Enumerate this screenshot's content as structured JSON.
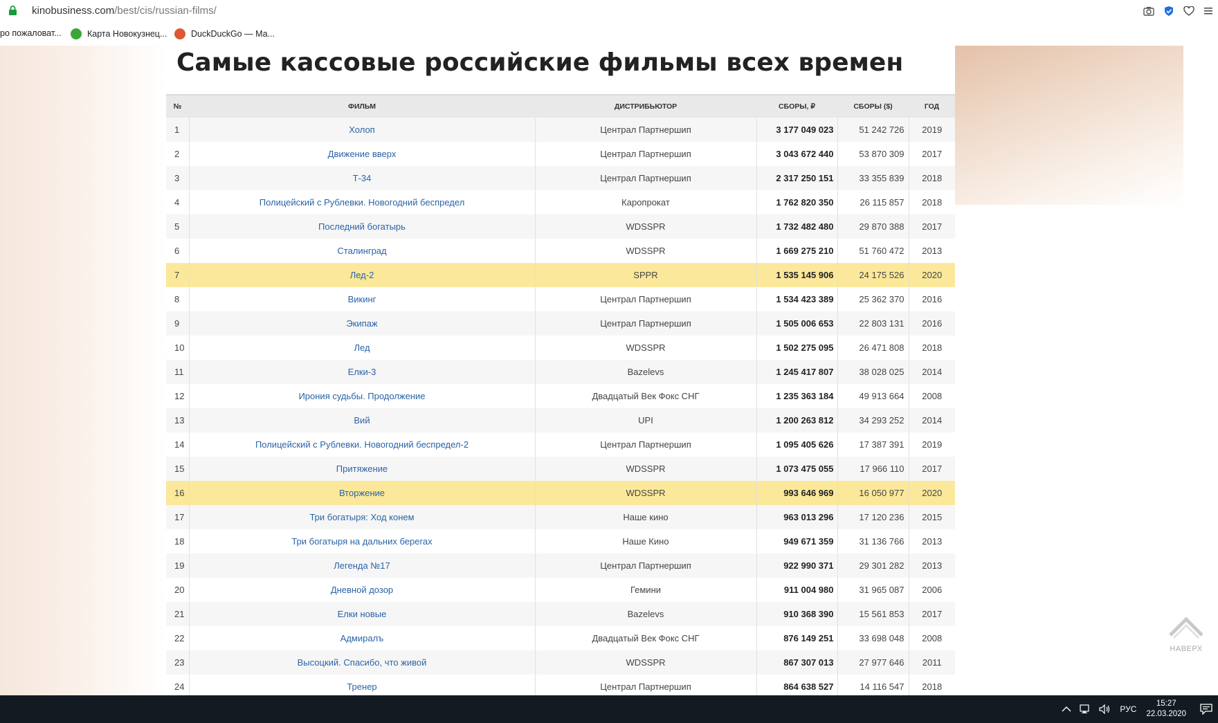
{
  "browser": {
    "url_host": "kinobusiness.com",
    "url_path": "/best/cis/russian-films/",
    "bookmarks": [
      {
        "label": "ро пожаловат..."
      },
      {
        "label": "Карта Новокузнец..."
      },
      {
        "label": "DuckDuckGo — Ма..."
      }
    ]
  },
  "page": {
    "title": "Самые кассовые российские фильмы всех времен",
    "back_to_top": "НАВЕРХ"
  },
  "table": {
    "headers": {
      "num": "№",
      "film": "ФИЛЬМ",
      "distributor": "ДИСТРИБЬЮТОР",
      "gross_rub": "СБОРЫ, ₽",
      "gross_usd": "СБОРЫ ($)",
      "year": "ГОД"
    },
    "rows": [
      {
        "num": "1",
        "film": "Холоп",
        "distributor": "Централ Партнершип",
        "gross_rub": "3 177 049 023",
        "gross_usd": "51 242 726",
        "year": "2019",
        "highlight": false
      },
      {
        "num": "2",
        "film": "Движение вверх",
        "distributor": "Централ Партнершип",
        "gross_rub": "3 043 672 440",
        "gross_usd": "53 870 309",
        "year": "2017",
        "highlight": false
      },
      {
        "num": "3",
        "film": "Т-34",
        "distributor": "Централ Партнершип",
        "gross_rub": "2 317 250 151",
        "gross_usd": "33 355 839",
        "year": "2018",
        "highlight": false
      },
      {
        "num": "4",
        "film": "Полицейский с Рублевки. Новогодний беспредел",
        "distributor": "Каропрокат",
        "gross_rub": "1 762 820 350",
        "gross_usd": "26 115 857",
        "year": "2018",
        "highlight": false
      },
      {
        "num": "5",
        "film": "Последний богатырь",
        "distributor": "WDSSPR",
        "gross_rub": "1 732 482 480",
        "gross_usd": "29 870 388",
        "year": "2017",
        "highlight": false
      },
      {
        "num": "6",
        "film": "Сталинград",
        "distributor": "WDSSPR",
        "gross_rub": "1 669 275 210",
        "gross_usd": "51 760 472",
        "year": "2013",
        "highlight": false
      },
      {
        "num": "7",
        "film": "Лед-2",
        "distributor": "SPPR",
        "gross_rub": "1 535 145 906",
        "gross_usd": "24 175 526",
        "year": "2020",
        "highlight": true
      },
      {
        "num": "8",
        "film": "Викинг",
        "distributor": "Централ Партнершип",
        "gross_rub": "1 534 423 389",
        "gross_usd": "25 362 370",
        "year": "2016",
        "highlight": false
      },
      {
        "num": "9",
        "film": "Экипаж",
        "distributor": "Централ Партнершип",
        "gross_rub": "1 505 006 653",
        "gross_usd": "22 803 131",
        "year": "2016",
        "highlight": false
      },
      {
        "num": "10",
        "film": "Лед",
        "distributor": "WDSSPR",
        "gross_rub": "1 502 275 095",
        "gross_usd": "26 471 808",
        "year": "2018",
        "highlight": false
      },
      {
        "num": "11",
        "film": "Елки-3",
        "distributor": "Bazelevs",
        "gross_rub": "1 245 417 807",
        "gross_usd": "38 028 025",
        "year": "2014",
        "highlight": false
      },
      {
        "num": "12",
        "film": "Ирония судьбы. Продолжение",
        "distributor": "Двадцатый Век Фокс СНГ",
        "gross_rub": "1 235 363 184",
        "gross_usd": "49 913 664",
        "year": "2008",
        "highlight": false
      },
      {
        "num": "13",
        "film": "Вий",
        "distributor": "UPI",
        "gross_rub": "1 200 263 812",
        "gross_usd": "34 293 252",
        "year": "2014",
        "highlight": false
      },
      {
        "num": "14",
        "film": "Полицейский с Рублевки. Новогодний беспредел-2",
        "distributor": "Централ Партнершип",
        "gross_rub": "1 095 405 626",
        "gross_usd": "17 387 391",
        "year": "2019",
        "highlight": false
      },
      {
        "num": "15",
        "film": "Притяжение",
        "distributor": "WDSSPR",
        "gross_rub": "1 073 475 055",
        "gross_usd": "17 966 110",
        "year": "2017",
        "highlight": false
      },
      {
        "num": "16",
        "film": "Вторжение",
        "distributor": "WDSSPR",
        "gross_rub": "993 646 969",
        "gross_usd": "16 050 977",
        "year": "2020",
        "highlight": true
      },
      {
        "num": "17",
        "film": "Три богатыря: Ход конем",
        "distributor": "Наше кино",
        "gross_rub": "963 013 296",
        "gross_usd": "17 120 236",
        "year": "2015",
        "highlight": false
      },
      {
        "num": "18",
        "film": "Три богатыря на дальних берегах",
        "distributor": "Наше Кино",
        "gross_rub": "949 671 359",
        "gross_usd": "31 136 766",
        "year": "2013",
        "highlight": false
      },
      {
        "num": "19",
        "film": "Легенда №17",
        "distributor": "Централ Партнершип",
        "gross_rub": "922 990 371",
        "gross_usd": "29 301 282",
        "year": "2013",
        "highlight": false
      },
      {
        "num": "20",
        "film": "Дневной дозор",
        "distributor": "Гемини",
        "gross_rub": "911 004 980",
        "gross_usd": "31 965 087",
        "year": "2006",
        "highlight": false
      },
      {
        "num": "21",
        "film": "Елки новые",
        "distributor": "Bazelevs",
        "gross_rub": "910 368 390",
        "gross_usd": "15 561 853",
        "year": "2017",
        "highlight": false
      },
      {
        "num": "22",
        "film": "Адмиралъ",
        "distributor": "Двадцатый Век Фокс СНГ",
        "gross_rub": "876 149 251",
        "gross_usd": "33 698 048",
        "year": "2008",
        "highlight": false
      },
      {
        "num": "23",
        "film": "Высоцкий. Спасибо, что живой",
        "distributor": "WDSSPR",
        "gross_rub": "867 307 013",
        "gross_usd": "27 977 646",
        "year": "2011",
        "highlight": false
      },
      {
        "num": "24",
        "film": "Тренер",
        "distributor": "Централ Партнершип",
        "gross_rub": "864 638 527",
        "gross_usd": "14 116 547",
        "year": "2018",
        "highlight": false
      }
    ]
  },
  "taskbar": {
    "language": "РУС",
    "time": "15:27",
    "date": "22.03.2020"
  },
  "colors": {
    "highlight_row": "#fbe89a",
    "link": "#2a63a7",
    "taskbar": "#131a22"
  },
  "icons": {
    "lock": "lock-icon",
    "camera": "camera-icon",
    "shield": "shield-icon",
    "heart": "heart-icon",
    "menu": "menu-icon",
    "back_to_top": "chevron-up-icon"
  }
}
